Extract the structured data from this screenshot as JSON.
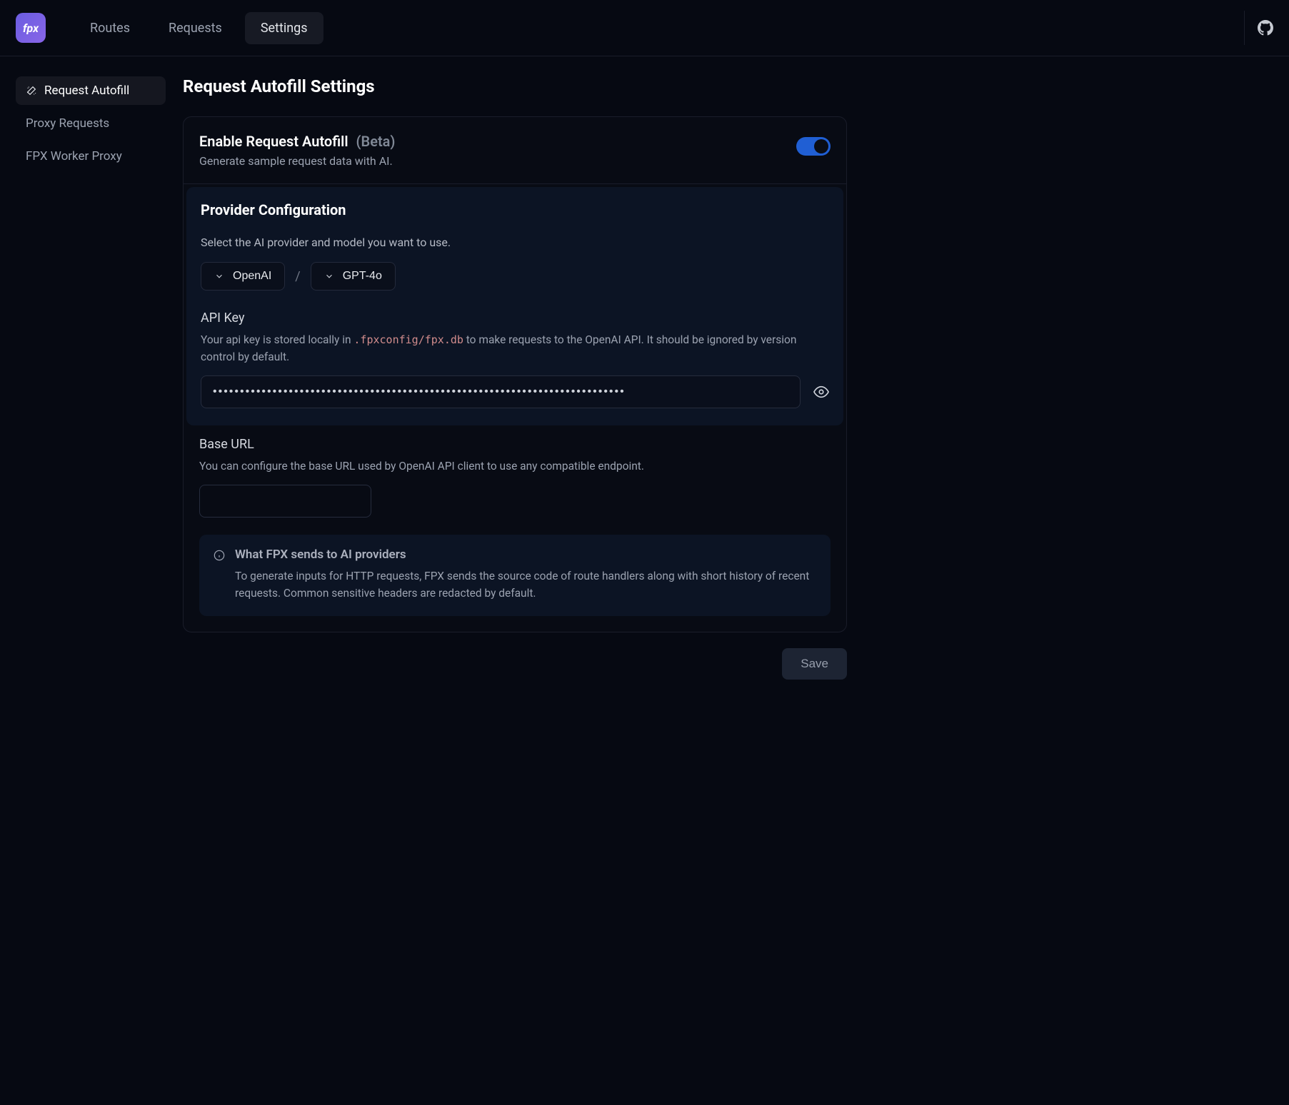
{
  "logo": "fpx",
  "nav": {
    "routes": "Routes",
    "requests": "Requests",
    "settings": "Settings"
  },
  "sidebar": {
    "autofill": "Request Autofill",
    "proxy": "Proxy Requests",
    "worker": "FPX Worker Proxy"
  },
  "page": {
    "title": "Request Autofill Settings"
  },
  "enable": {
    "title": "Enable Request Autofill",
    "beta": "(Beta)",
    "sub": "Generate sample request data with AI."
  },
  "provider": {
    "heading": "Provider Configuration",
    "sub": "Select the AI provider and model you want to use.",
    "vendor": "OpenAI",
    "model": "GPT-4o"
  },
  "apikey": {
    "label": "API Key",
    "help_pre": "Your api key is stored locally in ",
    "help_code": ".fpxconfig/fpx.db",
    "help_post": " to make requests to the OpenAI API. It should be ignored by version control by default.",
    "value": "••••••••••••••••••••••••••••••••••••••••••••••••••••••••••••••••••••••••••••"
  },
  "baseurl": {
    "label": "Base URL",
    "help": "You can configure the base URL used by OpenAI API client to use any compatible endpoint.",
    "value": ""
  },
  "info": {
    "title": "What FPX sends to AI providers",
    "text": "To generate inputs for HTTP requests, FPX sends the source code of route handlers along with short history of recent requests. Common sensitive headers are redacted by default."
  },
  "save": "Save"
}
